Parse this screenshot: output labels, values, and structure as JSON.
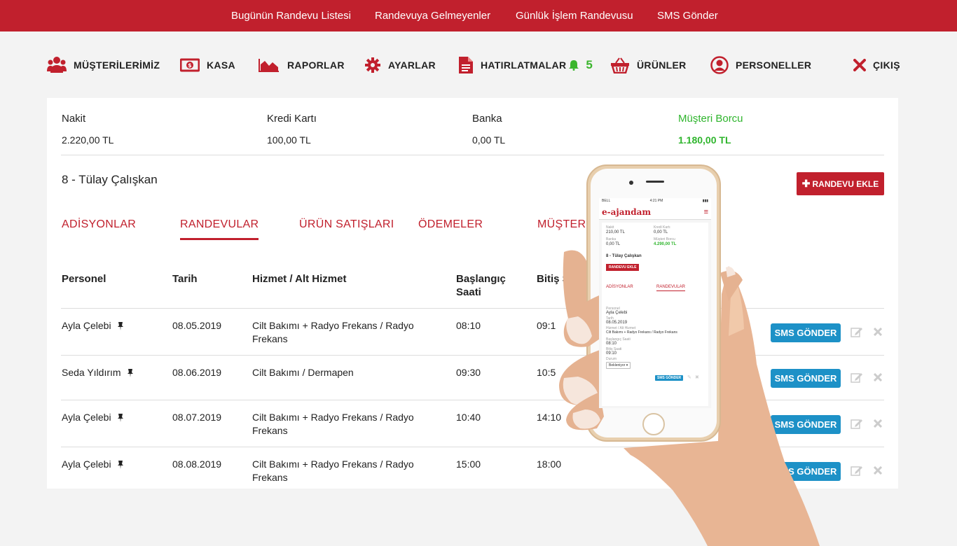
{
  "topbar": {
    "links": [
      "Bugünün Randevu Listesi",
      "Randevuya Gelmeyenler",
      "Günlük İşlem Randevusu",
      "SMS Gönder"
    ]
  },
  "nav": {
    "customers": "MÜŞTERİLERİMİZ",
    "cash": "KASA",
    "reports": "RAPORLAR",
    "settings": "AYARLAR",
    "reminders": "HATIRLATMALAR",
    "reminders_count": "5",
    "products": "ÜRÜNLER",
    "staff": "PERSONELLER",
    "logout": "ÇIKIŞ"
  },
  "summary": {
    "cash_label": "Nakit",
    "cash_value": "2.220,00 TL",
    "card_label": "Kredi Kartı",
    "card_value": "100,00 TL",
    "bank_label": "Banka",
    "bank_value": "0,00 TL",
    "debt_label": "Müşteri Borcu",
    "debt_value": "1.180,00 TL"
  },
  "customer": {
    "title": "8 - Tülay Çalışkan",
    "add_button": "RANDEVU EKLE"
  },
  "tabs": [
    "ADİSYONLAR",
    "RANDEVULAR",
    "ÜRÜN SATIŞLARI",
    "ÖDEMELER",
    "MÜŞTERİ"
  ],
  "table": {
    "headers": {
      "staff": "Personel",
      "date": "Tarih",
      "service": "Hizmet / Alt Hizmet",
      "start_1": "Başlangıç",
      "start_2": "Saati",
      "end": "Bitiş Saa"
    },
    "rows": [
      {
        "staff": "Ayla Çelebi",
        "date": "08.05.2019",
        "service_1": "Cilt Bakımı + Radyo Frekans / Radyo",
        "service_2": "Frekans",
        "start": "08:10",
        "end": "09:1",
        "sms": "SMS GÖNDER"
      },
      {
        "staff": "Seda Yıldırım",
        "date": "08.06.2019",
        "service_1": "Cilt Bakımı / Dermapen",
        "service_2": "",
        "start": "09:30",
        "end": "10:5",
        "sms": "SMS GÖNDER"
      },
      {
        "staff": "Ayla Çelebi",
        "date": "08.07.2019",
        "service_1": "Cilt Bakımı + Radyo Frekans / Radyo",
        "service_2": "Frekans",
        "start": "10:40",
        "end": "14:10",
        "sms": "SMS GÖNDER"
      },
      {
        "staff": "Ayla Çelebi",
        "date": "08.08.2019",
        "service_1": "Cilt Bakımı + Radyo Frekans / Radyo",
        "service_2": "Frekans",
        "start": "15:00",
        "end": "18:00",
        "sms": "SMS GÖNDER"
      }
    ]
  },
  "phone": {
    "carrier": "BELL",
    "time": "4:21 PM",
    "logo": "e-ajandam",
    "cash_label": "Nakit",
    "cash_value": "210,00 TL",
    "card_label": "Kredi Kartı",
    "card_value": "0,00 TL",
    "bank_label": "Banka",
    "bank_value": "0,00 TL",
    "debt_label": "Müşteri Borcu",
    "debt_value": "4.290,00 TL",
    "customer": "8 - Tülay Çalışkan",
    "add_button": "RANDEVU EKLE",
    "tab1": "ADİSYONLAR",
    "tab2": "RANDEVULAR",
    "staff_label": "Personel",
    "staff_value": "Ayla Çelebi",
    "date_label": "Tarih",
    "date_value": "08.05.2019",
    "service_label": "Hizmet / Alt Hizmet",
    "service_value": "Cilt Bakımı + Radyo Frekans / Radyo Frekans",
    "start_label": "Başlangıç Saati",
    "start_value": "08:10",
    "end_label": "Bitiş Saati",
    "end_value": "09:10",
    "status_label": "Durum",
    "status_value": "Bekleniyor",
    "sms": "SMS GÖNDER"
  },
  "colors": {
    "brand_red": "#c1202d",
    "green": "#2fb52d",
    "sms_blue": "#1d91c7"
  }
}
